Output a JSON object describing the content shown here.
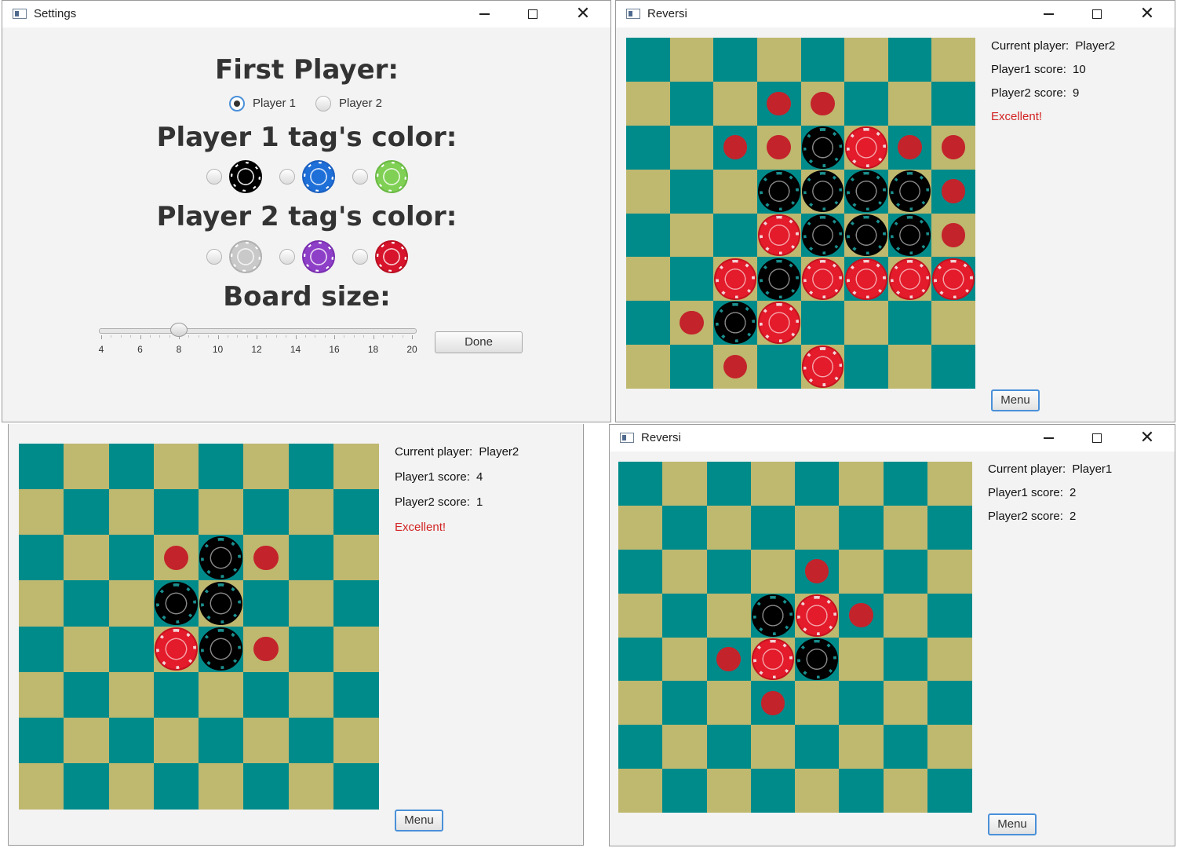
{
  "settings": {
    "title": "Settings",
    "first_player_heading": "First Player:",
    "first_player_options": [
      "Player 1",
      "Player 2"
    ],
    "first_player_selected": "Player 1",
    "p1_color_heading": "Player 1 tag's color:",
    "p1_colors": [
      "black",
      "blue",
      "green"
    ],
    "p2_color_heading": "Player 2 tag's color:",
    "p2_colors": [
      "grey",
      "purple",
      "red"
    ],
    "board_size_heading": "Board size:",
    "board_size_value": 8,
    "slider_ticks": [
      "4",
      "6",
      "8",
      "10",
      "12",
      "14",
      "16",
      "18",
      "20"
    ],
    "done_label": "Done"
  },
  "game1": {
    "title": "Reversi",
    "current_player_label": "Current player:",
    "current_player": "Player2",
    "p1_score_label": "Player1 score:",
    "p1_score": "10",
    "p2_score_label": "Player2 score:",
    "p2_score": "9",
    "message": "Excellent!",
    "menu_label": "Menu",
    "board": [
      "........",
      "...hh...",
      "..hhBRhh",
      "...BBBBh",
      "...RBBBh",
      "..RBRRRR",
      ".hBR....",
      "..h.R..."
    ]
  },
  "game2": {
    "title": "",
    "current_player_label": "Current player:",
    "current_player": "Player2",
    "p1_score_label": "Player1 score:",
    "p1_score": "4",
    "p2_score_label": "Player2 score:",
    "p2_score": "1",
    "message": "Excellent!",
    "menu_label": "Menu",
    "board": [
      "........",
      "........",
      "...hBh..",
      "...BB...",
      "...RBh..",
      "........",
      "........",
      "........"
    ]
  },
  "game3": {
    "title": "Reversi",
    "current_player_label": "Current player:",
    "current_player": "Player1",
    "p1_score_label": "Player1 score:",
    "p1_score": "2",
    "p2_score_label": "Player2 score:",
    "p2_score": "2",
    "message": "",
    "menu_label": "Menu",
    "board": [
      "........",
      "........",
      "....h...",
      "...BRh..",
      "..hRB...",
      "...h....",
      "........",
      "........"
    ]
  },
  "colors": {
    "teal": "#008b8b",
    "khaki": "#bfb86f",
    "hint": "#c3232b",
    "excellent": "#d22222",
    "focus_blue": "#4a90d9"
  },
  "icons": {
    "minimize": "minimize-icon",
    "maximize": "maximize-icon",
    "close": "close-icon",
    "app": "java-app-icon"
  }
}
